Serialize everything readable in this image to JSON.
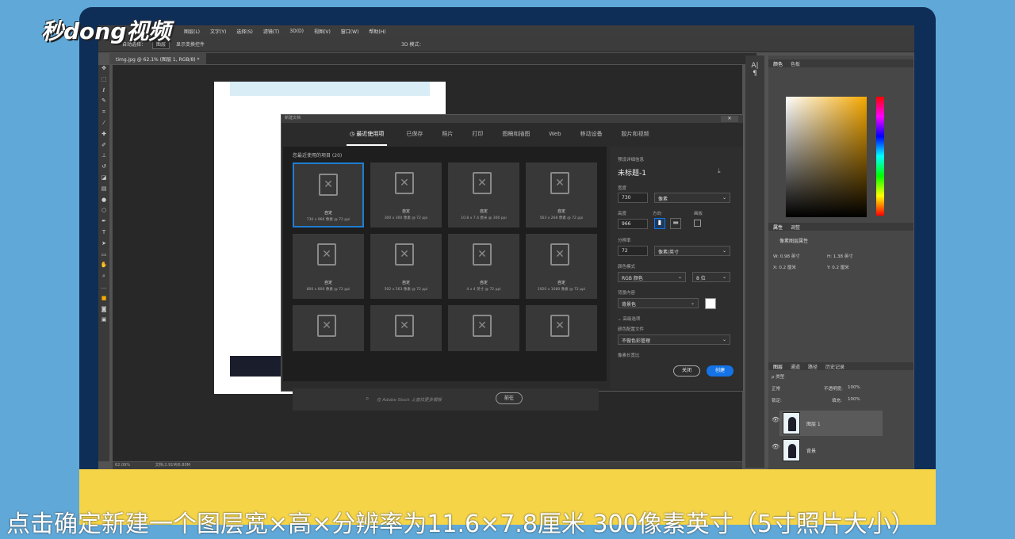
{
  "logo": {
    "text": "秒dong视频"
  },
  "menubar": [
    "图层(L)",
    "文字(Y)",
    "选择(S)",
    "滤镜(T)",
    "3D(D)",
    "视图(V)",
    "窗口(W)",
    "帮助(H)"
  ],
  "optbar": {
    "auto_select": "自动选择：",
    "layer_mode": "图层",
    "show_transform": "显示变换控件",
    "mode3d": "3D 模式："
  },
  "document_tab": "timg.jpg @ 62.1% (图层 1, RGB/8) *",
  "status": {
    "zoom": "62.09%",
    "doc": "文档:2.91M/6.80M"
  },
  "dialog": {
    "title": "新建文档",
    "close": "✕",
    "tabs": [
      "最近使用项",
      "已保存",
      "照片",
      "打印",
      "图稿和插图",
      "Web",
      "移动设备",
      "胶片和视频"
    ],
    "recent_header": "您最近使用的项目 (20)",
    "presets": [
      {
        "name": "自定",
        "size": "730 x 966 像素 @ 72 ppi"
      },
      {
        "name": "自定",
        "size": "300 x 300 像素 @ 72 ppi"
      },
      {
        "name": "自定",
        "size": "10.8 x 7.4 厘米 @ 300 ppi"
      },
      {
        "name": "自定",
        "size": "563 x 268 像素 @ 72 ppi"
      },
      {
        "name": "自定",
        "size": "800 x 800 像素 @ 72 ppi"
      },
      {
        "name": "自定",
        "size": "502 x 563 像素 @ 72 ppi"
      },
      {
        "name": "自定",
        "size": "4 x 4 英寸 @ 72 ppi"
      },
      {
        "name": "自定",
        "size": "1920 x 1080 像素 @ 72 ppi"
      }
    ],
    "search_placeholder": "在 Adobe Stock 上查找更多模板",
    "go_button": "前往",
    "details": {
      "header": "预设详细信息",
      "doc_name": "未标题-1",
      "width_label": "宽度",
      "width": "730",
      "width_unit": "像素",
      "height_label": "高度",
      "height": "966",
      "orientation_label": "方向",
      "artboard_label": "画板",
      "resolution_label": "分辨率",
      "resolution": "72",
      "resolution_unit": "像素/英寸",
      "color_mode_label": "颜色模式",
      "color_mode": "RGB 颜色",
      "bit_depth": "8 位",
      "bg_label": "背景内容",
      "bg": "背景色",
      "advanced": "高级选项",
      "profile_label": "颜色配置文件",
      "profile": "不做色彩管理",
      "pixel_aspect_label": "像素长宽比",
      "close_btn": "关闭",
      "create_btn": "创建"
    }
  },
  "panels": {
    "color_tabs": [
      "颜色",
      "色板"
    ],
    "props_tabs": [
      "属性",
      "调整"
    ],
    "props_title": "像素图层属性",
    "props": {
      "w": "W: 0.98 英寸",
      "h": "H: 1.38 英寸",
      "x": "X: 0.2 厘米",
      "y": "Y: 0.2 厘米"
    },
    "layers_tabs": [
      "图层",
      "通道",
      "路径",
      "历史记录"
    ],
    "kind": "ρ 类型",
    "blend": "正常",
    "opacity_label": "不透明度:",
    "opacity": "100%",
    "lock_label": "锁定:",
    "fill_label": "填充:",
    "fill": "100%",
    "layers": [
      "图层 1",
      "背景"
    ]
  },
  "caption": "点击确定新建一个图层宽×高×分辨率为11.6×7.8厘米 300像素英寸（5寸照片大小）",
  "colors": {
    "accent": "#1473e6",
    "yellow": "#f5d547",
    "frame": "#0f2e57"
  }
}
